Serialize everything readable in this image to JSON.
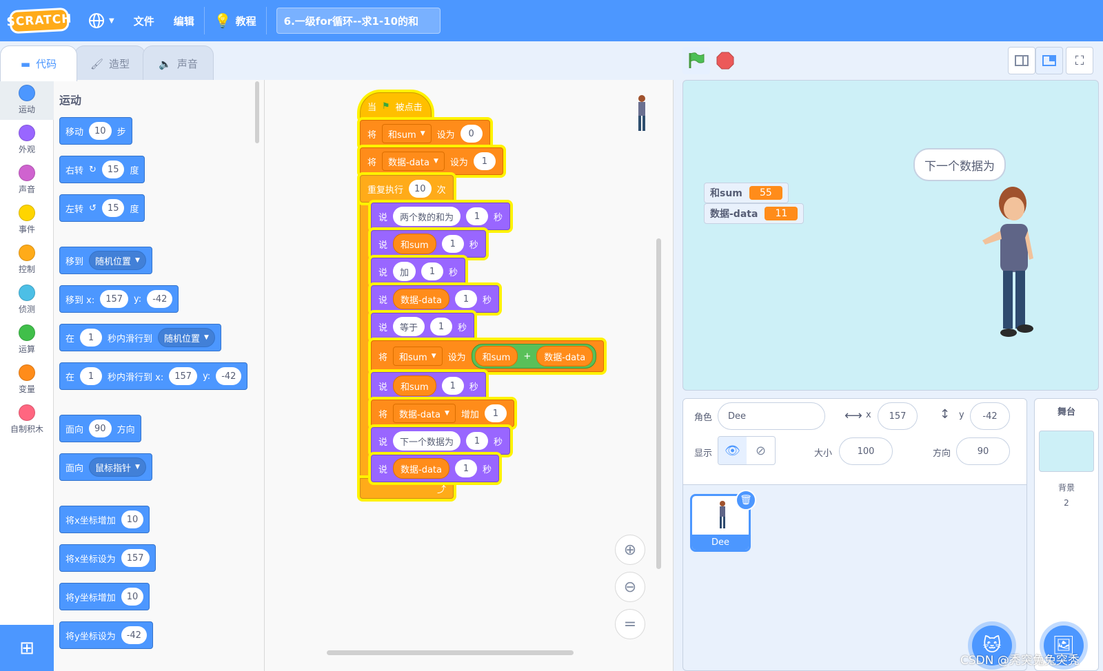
{
  "menu": {
    "logo": "SCRATCH",
    "language_icon": "globe-icon",
    "file": "文件",
    "edit": "编辑",
    "tutorials": "教程",
    "project_title": "6.一级for循环--求1-10的和"
  },
  "tabs": {
    "code": "代码",
    "costumes": "造型",
    "sounds": "声音"
  },
  "categories": [
    {
      "label": "运动",
      "color": "#4c97ff"
    },
    {
      "label": "外观",
      "color": "#9966ff"
    },
    {
      "label": "声音",
      "color": "#cf63cf"
    },
    {
      "label": "事件",
      "color": "#ffd500"
    },
    {
      "label": "控制",
      "color": "#ffab19"
    },
    {
      "label": "侦测",
      "color": "#4cbfe6"
    },
    {
      "label": "运算",
      "color": "#40bf4a"
    },
    {
      "label": "变量",
      "color": "#ff8c1a"
    },
    {
      "label": "自制积木",
      "color": "#ff6680"
    }
  ],
  "palette": {
    "title": "运动",
    "move": {
      "label": "移动",
      "value": "10",
      "unit": "步"
    },
    "turn_right": {
      "label": "右转",
      "value": "15",
      "unit": "度"
    },
    "turn_left": {
      "label": "左转",
      "value": "15",
      "unit": "度"
    },
    "goto": {
      "label": "移到",
      "target": "随机位置"
    },
    "goto_xy": {
      "label": "移到 x:",
      "x": "157",
      "ylabel": "y:",
      "y": "-42"
    },
    "glide": {
      "label": "在",
      "secs": "1",
      "mid": "秒内滑行到",
      "target": "随机位置"
    },
    "glide_xy": {
      "label": "在",
      "secs": "1",
      "mid": "秒内滑行到 x:",
      "x": "157",
      "ylabel": "y:",
      "y": "-42"
    },
    "point_dir": {
      "label": "面向",
      "value": "90",
      "unit": "方向"
    },
    "point_towards": {
      "label": "面向",
      "target": "鼠标指针"
    },
    "change_x": {
      "label": "将x坐标增加",
      "value": "10"
    },
    "set_x": {
      "label": "将x坐标设为",
      "value": "157"
    },
    "change_y": {
      "label": "将y坐标增加",
      "value": "10"
    },
    "set_y": {
      "label": "将y坐标设为",
      "value": "-42"
    }
  },
  "script": {
    "hat": {
      "when": "当",
      "clicked": "被点击"
    },
    "set1": {
      "set": "将",
      "var": "和sum",
      "to": "设为",
      "value": "0"
    },
    "set2": {
      "set": "将",
      "var": "数据-data",
      "to": "设为",
      "value": "1"
    },
    "repeat": {
      "label": "重复执行",
      "value": "10",
      "unit": "次"
    },
    "say1": {
      "say": "说",
      "text": "两个数的和为",
      "secs": "1",
      "unit": "秒"
    },
    "say2": {
      "say": "说",
      "text": "和sum",
      "secs": "1",
      "unit": "秒"
    },
    "say3": {
      "say": "说",
      "text": "加",
      "secs": "1",
      "unit": "秒"
    },
    "say4": {
      "say": "说",
      "text": "数据-data",
      "secs": "1",
      "unit": "秒"
    },
    "say5": {
      "say": "说",
      "text": "等于",
      "secs": "1",
      "unit": "秒"
    },
    "set3": {
      "set": "将",
      "var": "和sum",
      "to": "设为",
      "a": "和sum",
      "op": "+",
      "b": "数据-data"
    },
    "say6": {
      "say": "说",
      "text": "和sum",
      "secs": "1",
      "unit": "秒"
    },
    "change": {
      "set": "将",
      "var": "数据-data",
      "by": "增加",
      "value": "1"
    },
    "say7": {
      "say": "说",
      "text": "下一个数据为",
      "secs": "1",
      "unit": "秒"
    },
    "say8": {
      "say": "说",
      "text": "数据-data",
      "secs": "1",
      "unit": "秒"
    }
  },
  "stage": {
    "monitors": [
      {
        "name": "和sum",
        "value": "55"
      },
      {
        "name": "数据-data",
        "value": "11"
      }
    ],
    "speech": "下一个数据为"
  },
  "sprite_info": {
    "sprite_label": "角色",
    "name": "Dee",
    "x_label": "x",
    "x": "157",
    "y_label": "y",
    "y": "-42",
    "show_label": "显示",
    "size_label": "大小",
    "size": "100",
    "direction_label": "方向",
    "direction": "90"
  },
  "sprites": [
    {
      "name": "Dee"
    }
  ],
  "stage_pane": {
    "title": "舞台",
    "backdrops_label": "背景",
    "backdrops_count": "2"
  },
  "watermark": "CSDN @秃突兔兔突秃"
}
